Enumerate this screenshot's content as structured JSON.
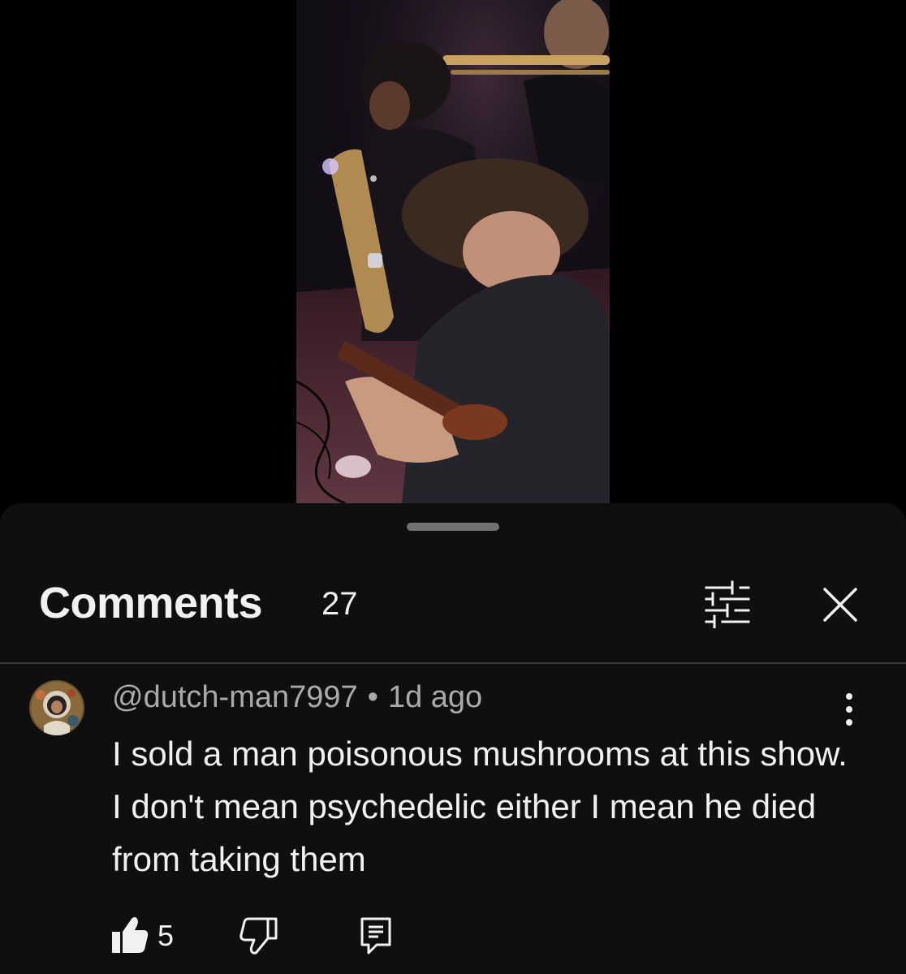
{
  "sheet": {
    "title": "Comments",
    "count": "27",
    "filter_icon": "sort-filter-icon",
    "close_icon": "close-icon"
  },
  "comment": {
    "author": "@dutch-man7997",
    "separator": "•",
    "time": "1d ago",
    "text": "I sold a man poisonous mushrooms at this show. I don't mean psychedelic either I mean he died from taking them",
    "likes": "5",
    "more_icon": "more-vertical-icon",
    "like_icon": "thumbs-up-filled-icon",
    "dislike_icon": "thumbs-down-icon",
    "reply_icon": "reply-icon"
  },
  "colors": {
    "background": "#000000",
    "sheet": "#0f0f0f",
    "primary_text": "#f1f1f1",
    "secondary_text": "#aaaaaa",
    "divider": "#3a3a3a"
  }
}
